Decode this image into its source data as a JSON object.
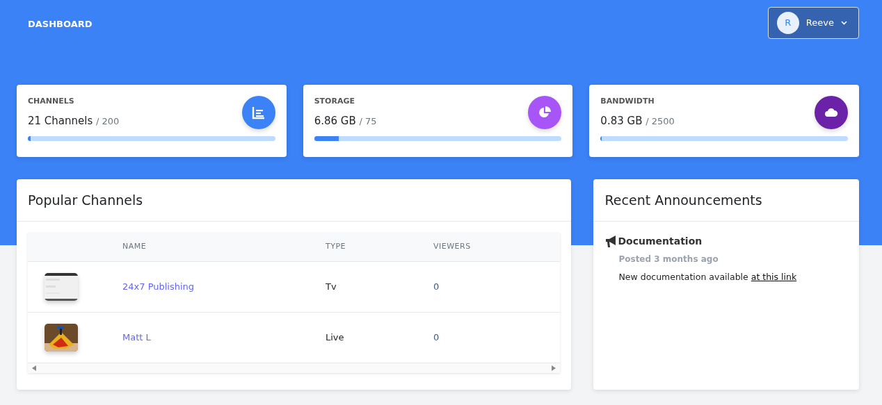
{
  "header": {
    "title": "DASHBOARD",
    "user": {
      "initial": "R",
      "name": "Reeve"
    }
  },
  "stats": [
    {
      "label": "CHANNELS",
      "value": "21 Channels",
      "total": "/ 200",
      "level": 0.01,
      "color": "#3b82f6"
    },
    {
      "label": "STORAGE",
      "value": "6.86 GB",
      "total": "/ 75",
      "level": 0.1,
      "color": "#a855f7"
    },
    {
      "label": "BANDWIDTH",
      "value": "0.83 GB",
      "total": "/ 2500",
      "level": 0.005,
      "color": "#6b21a8"
    }
  ],
  "popular": {
    "title": "Popular Channels",
    "columns": [
      "NAME",
      "TYPE",
      "VIEWERS"
    ],
    "rows": [
      {
        "name": "24x7 Publishing",
        "type": "Tv",
        "viewers": "0"
      },
      {
        "name": "Matt L",
        "type": "Live",
        "viewers": "0"
      }
    ]
  },
  "announcements": {
    "title": "Recent Announcements",
    "items": [
      {
        "title": "Documentation",
        "posted": "Posted 3 months ago",
        "text": "New documentation available ",
        "link": "at this link"
      }
    ]
  }
}
